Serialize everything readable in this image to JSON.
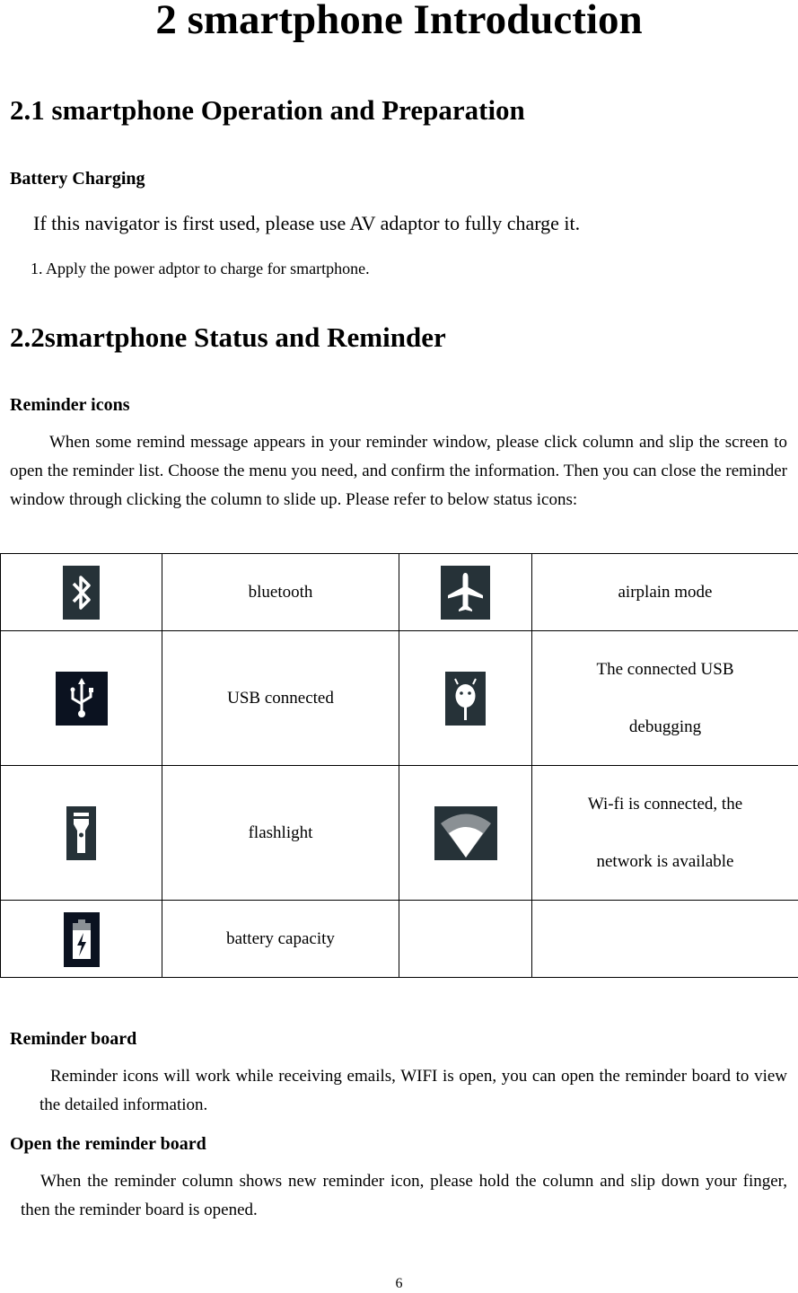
{
  "page": {
    "title": "2 smartphone Introduction",
    "section_1": {
      "heading": "2.1 smartphone Operation and Preparation",
      "subheading": "Battery Charging",
      "paragraph": "If this navigator is first used, please use AV adaptor to fully charge it.",
      "list_item": "1. Apply the power adptor to charge for smartphone."
    },
    "section_2": {
      "heading": "2.2smartphone Status and Reminder",
      "reminder_icons": {
        "subheading": "Reminder icons",
        "paragraph": "When some remind message appears in your reminder window, please click column and slip the screen to open the reminder list. Choose the menu you need, and confirm the information. Then you can close the reminder window through clicking the column to slide up. Please refer to below status icons:"
      },
      "status_table": {
        "rows": [
          {
            "left": {
              "icon": "bluetooth-icon",
              "label": "bluetooth"
            },
            "right": {
              "icon": "airplane-mode-icon",
              "label_line1": "airplain mode",
              "label_line2": ""
            }
          },
          {
            "left": {
              "icon": "usb-icon",
              "label": "USB connected"
            },
            "right": {
              "icon": "usb-debugging-icon",
              "label_line1": "The connected USB",
              "label_line2": "debugging"
            }
          },
          {
            "left": {
              "icon": "flashlight-icon",
              "label": "flashlight"
            },
            "right": {
              "icon": "wifi-icon",
              "label_line1": "Wi-fi is connected, the",
              "label_line2": "network is available"
            }
          },
          {
            "left": {
              "icon": "battery-charging-icon",
              "label": "battery capacity"
            },
            "right": {
              "icon": "",
              "label_line1": "",
              "label_line2": ""
            }
          }
        ]
      },
      "reminder_board": {
        "subheading": "Reminder board",
        "paragraph": "Reminder icons will work while receiving emails, WIFI is open, you can open the reminder board to view the detailed information."
      },
      "open_board": {
        "subheading": "Open the reminder board",
        "paragraph": "When the reminder column shows new reminder icon, please hold the column and slip down your finger, then the reminder board is opened."
      }
    },
    "page_number": "6"
  }
}
